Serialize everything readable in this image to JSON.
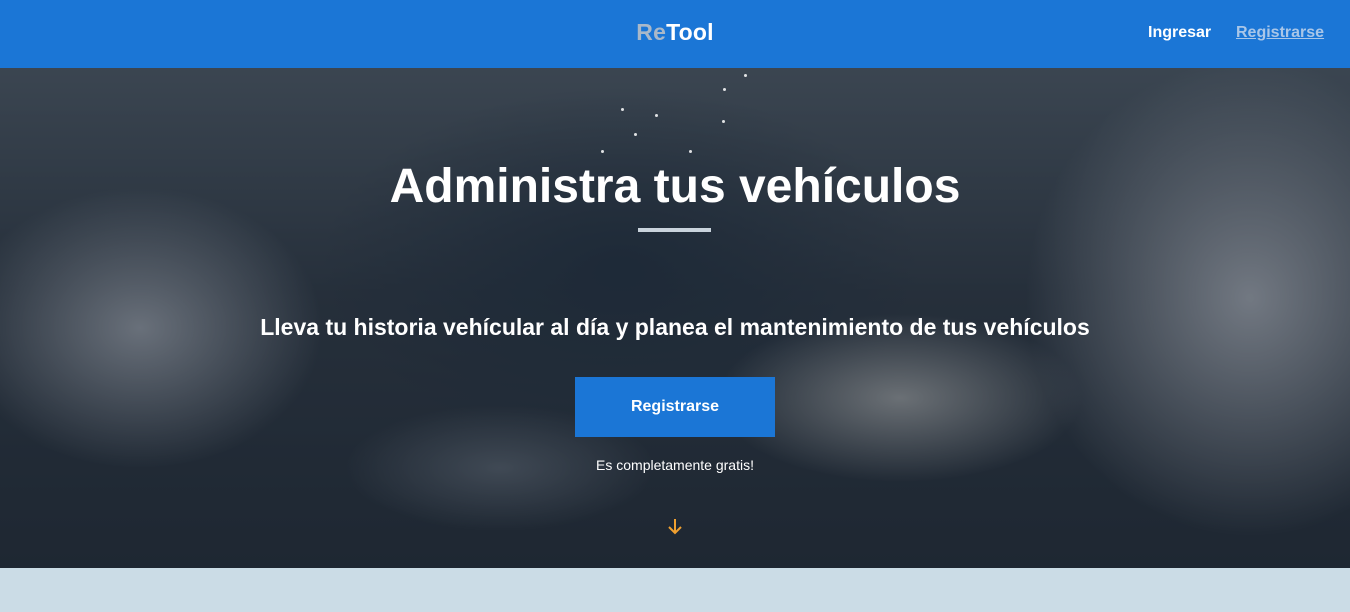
{
  "header": {
    "logo_part1": "Re",
    "logo_part2": "Tool",
    "login_label": "Ingresar",
    "register_label": "Registrarse"
  },
  "hero": {
    "title": "Administra tus vehículos",
    "subtitle": "Lleva tu historia vehícular al día y planea el mantenimiento de tus vehículos",
    "cta_label": "Registrarse",
    "cta_note": "Es completamente gratis!",
    "scroll_icon": "arrow-down-icon"
  },
  "colors": {
    "brand_blue": "#1b76d6",
    "accent_orange": "#f0a030",
    "section_background": "#cbdce6"
  }
}
